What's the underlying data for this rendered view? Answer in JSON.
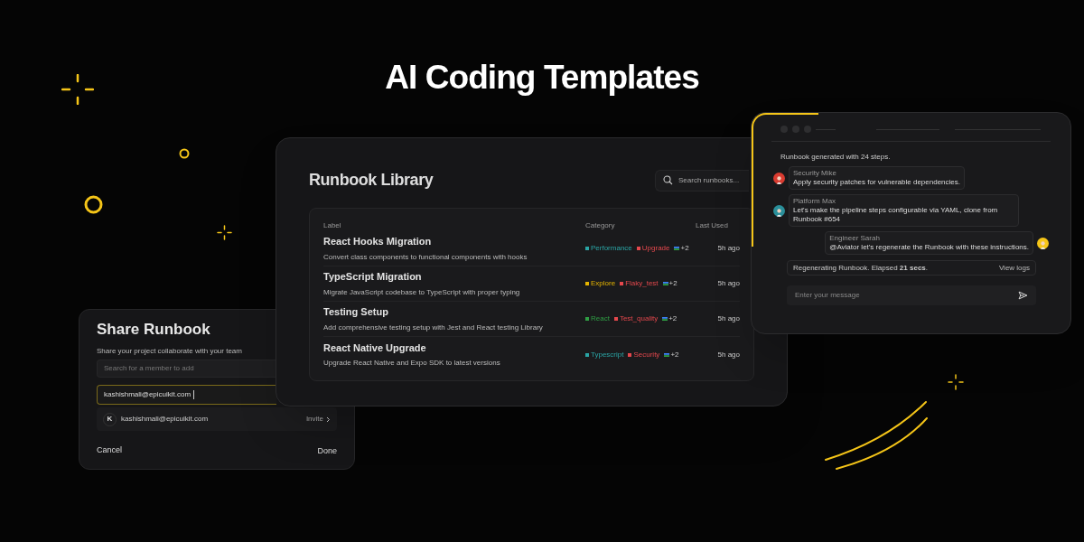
{
  "headline": "AI Coding Templates",
  "library": {
    "title": "Runbook Library",
    "search": {
      "placeholder": "Search runbooks..."
    },
    "columns": [
      "Label",
      "Category",
      "Last Used"
    ],
    "rows": [
      {
        "title": "React Hooks Migration",
        "description": "Convert class components to functional components with hooks",
        "tags": [
          {
            "label": "Performance",
            "color": "#2aa5a5"
          },
          {
            "label": "Upgrade",
            "color": "#e5484d"
          }
        ],
        "more": "+2",
        "last_used": "5h ago"
      },
      {
        "title": "TypeScript Migration",
        "description": "Migrate JavaScript codebase to TypeScript with proper typing",
        "tags": [
          {
            "label": "Explore",
            "color": "#e5b400"
          },
          {
            "label": "Flaky_test",
            "color": "#e5484d"
          }
        ],
        "more": "+2",
        "last_used": "5h ago"
      },
      {
        "title": "Testing Setup",
        "description": "Add comprehensive testing setup with Jest and React testing Library",
        "tags": [
          {
            "label": "React",
            "color": "#2f9e44"
          },
          {
            "label": "Test_quality",
            "color": "#e5484d"
          }
        ],
        "more": "+2",
        "last_used": "5h ago"
      },
      {
        "title": "React Native Upgrade",
        "description": "Upgrade React Native and Expo SDK to latest versions",
        "tags": [
          {
            "label": "Typescript",
            "color": "#2aa5a5"
          },
          {
            "label": "Security",
            "color": "#e5484d"
          }
        ],
        "more": "+2",
        "last_used": "5h ago"
      }
    ]
  },
  "chat": {
    "intro": "Runbook generated with 24 steps.",
    "messages": [
      {
        "kind": "left",
        "author": "Security Mike",
        "text": "Apply security patches for vulnerable dependencies.",
        "color": "#d93b30"
      },
      {
        "kind": "left",
        "author": "Platform Max",
        "text": "Let's make the pipeline steps configurable via YAML, clone from Runbook #654",
        "color": "#2a8f9a"
      },
      {
        "kind": "right",
        "author": "Engineer Sarah",
        "text": "@Aviator let's regenerate the Runbook with these instructions.",
        "color": "#f5c518"
      }
    ],
    "status": {
      "text": "Regenerating Runbook. Elapsed **21 secs**.",
      "action": "View logs"
    },
    "input": {
      "placeholder": "Enter your message"
    }
  },
  "share": {
    "title": "Share Runbook",
    "subtitle": "Share your project collaborate with your team",
    "search": {
      "placeholder": "Search for a member to add"
    },
    "email": {
      "value": "kashishmali@epicuikit.com"
    },
    "suggestion": {
      "initial": "K",
      "email": "kashishmali@epicuikit.com",
      "action": "Invite"
    },
    "buttons": [
      "Cancel",
      "Done"
    ]
  }
}
